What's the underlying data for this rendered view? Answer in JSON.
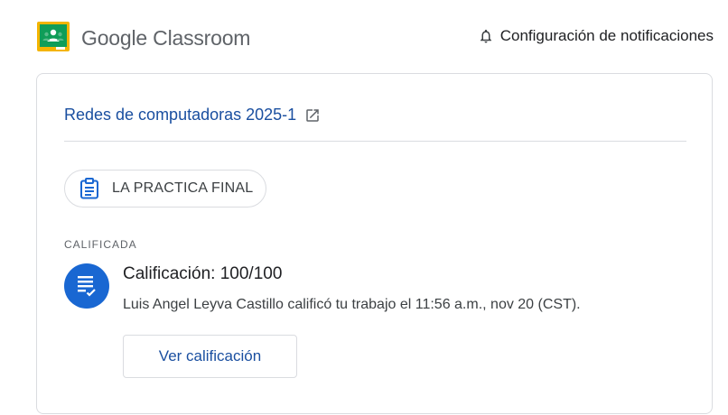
{
  "header": {
    "logo_text": "Google Classroom",
    "notifications_label": "Configuración de notificaciones"
  },
  "card": {
    "course_name": "Redes de computadoras 2025-1",
    "assignment_title": "LA PRACTICA FINAL",
    "status": "CALIFICADA",
    "grade_title": "Calificación: 100/100",
    "grade_description": "Luis Angel Leyva Castillo calificó tu trabajo el 11:56 a.m., nov 20 (CST).",
    "view_button_label": "Ver calificación"
  },
  "icons": {
    "logo": "google-classroom-logo-icon",
    "bell": "bell-icon",
    "external": "open-in-new-icon",
    "assignment": "clipboard-icon",
    "grade": "graded-document-icon"
  },
  "colors": {
    "accent_link": "#1a4fa0",
    "grade_circle": "#1967d2",
    "classroom_green": "#0f9d58",
    "classroom_yellow": "#f4b400"
  }
}
